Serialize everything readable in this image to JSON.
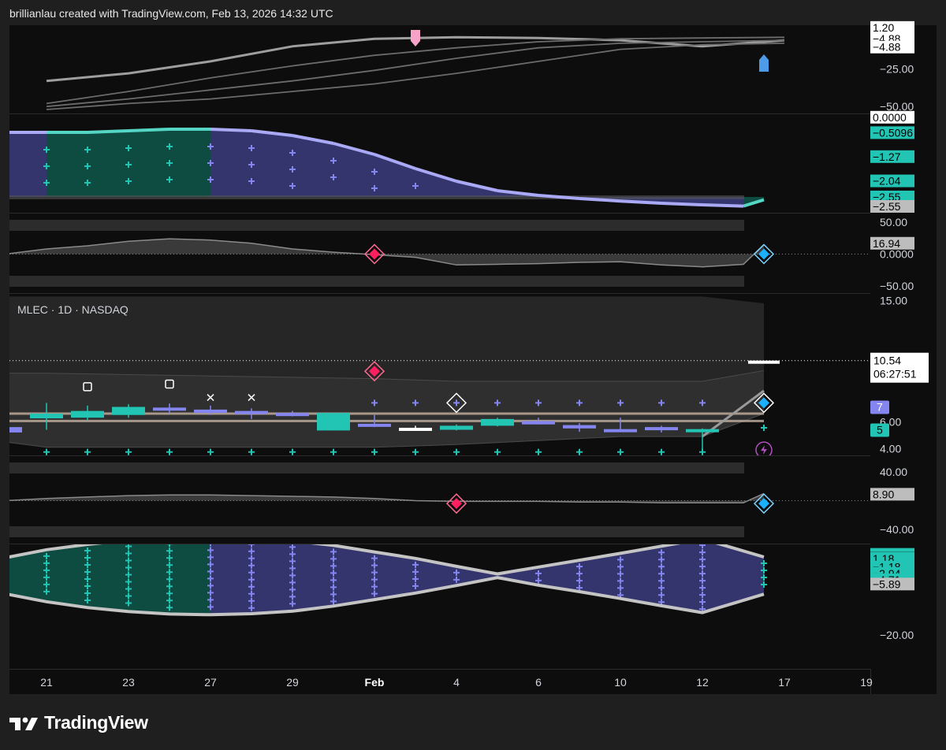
{
  "header": {
    "credit": "brillianlau created with TradingView.com, Feb 13, 2026 14:32 UTC"
  },
  "brand": {
    "name": "TradingView"
  },
  "colors": {
    "teal": "#22c4b4",
    "purple": "#8585f0",
    "teal_fill": "#0e4b40",
    "purple_fill": "#35356e",
    "pink_red": "#ff1f5f",
    "cyan_blue": "#1ab0ff",
    "pink_marker": "#f7a3c8",
    "blue_marker": "#4c9ae8",
    "grey_line": "#9a9a9a",
    "bg": "#0d0d0d",
    "frame": "#1f1f1f"
  },
  "symbol": {
    "label": "MLEC · 1D · NASDAQ"
  },
  "chart_data": [
    {
      "id": "pane1",
      "type": "line",
      "title": "",
      "ylim": [
        -52,
        4
      ],
      "yticks": [
        {
          "v": -25,
          "label": "−25.00"
        },
        {
          "v": -50,
          "label": "−50.00"
        }
      ],
      "price_tags": [
        {
          "v": 2.5,
          "label": "1.20",
          "style": "white",
          "partial": true
        },
        {
          "v": -4.9,
          "label": "−4.88",
          "style": "white"
        },
        {
          "v": -10.5,
          "label": "−4.88",
          "style": "white"
        }
      ],
      "x": [
        0,
        2,
        4,
        6,
        8,
        10,
        12,
        14,
        16,
        18
      ],
      "series": [
        {
          "role": "main",
          "values": [
            -33,
            -28,
            -20,
            -10,
            -5,
            -4,
            -4.5,
            -6,
            -10,
            -6
          ]
        },
        {
          "role": "ma",
          "values": [
            -48,
            -40,
            -31,
            -23,
            -16,
            -11,
            -7,
            -5,
            -4.5,
            -4
          ]
        },
        {
          "role": "ma",
          "values": [
            -50,
            -45,
            -39,
            -33,
            -26,
            -18,
            -11,
            -8,
            -7,
            -6
          ]
        },
        {
          "role": "ma",
          "values": [
            -52,
            -48,
            -45,
            -40,
            -35,
            -28,
            -20,
            -12,
            -9,
            -8
          ]
        }
      ],
      "markers": [
        {
          "x": 9,
          "shape": "flag-down",
          "color": "pink"
        },
        {
          "x": 17.5,
          "shape": "flag-up",
          "color": "blue"
        }
      ]
    },
    {
      "id": "pane2",
      "type": "area",
      "title": "",
      "ylim": [
        -2.85,
        0
      ],
      "price_tags": [
        {
          "v": -0.02,
          "label": "0.0000",
          "style": "white"
        },
        {
          "v": -0.5096,
          "label": "−0.5096",
          "style": "teal"
        },
        {
          "v": -1.27,
          "label": "−1.27",
          "style": "teal"
        },
        {
          "v": -2.04,
          "label": "−2.04",
          "style": "teal"
        },
        {
          "v": -2.55,
          "label": "−2.55",
          "style": "teal"
        },
        {
          "v": -2.85,
          "label": "−2.55",
          "style": "grey"
        }
      ],
      "x": [
        -1,
        0,
        1,
        2,
        3,
        4,
        5,
        6,
        7,
        8,
        9,
        10,
        11,
        12,
        13,
        14,
        15,
        16,
        17,
        17.5
      ],
      "values": [
        -0.5,
        -0.5,
        -0.5,
        -0.45,
        -0.4,
        -0.4,
        -0.45,
        -0.6,
        -0.85,
        -1.2,
        -1.65,
        -2.05,
        -2.35,
        -2.5,
        -2.6,
        -2.68,
        -2.75,
        -2.8,
        -2.84,
        -2.64
      ],
      "baseline": -2.55,
      "segment_colors": [
        "purple",
        "teal",
        "teal",
        "teal",
        "teal",
        "purple",
        "purple",
        "purple",
        "purple",
        "purple",
        "purple",
        "purple",
        "purple",
        "purple",
        "purple",
        "purple",
        "purple",
        "purple",
        "teal",
        "teal"
      ]
    },
    {
      "id": "pane3",
      "type": "area",
      "title": "",
      "ylim": [
        -50,
        50
      ],
      "yticks": [
        {
          "v": 50,
          "label": "50.00"
        },
        {
          "v": 0,
          "label": "0.0000"
        },
        {
          "v": -50,
          "label": "−50.00"
        }
      ],
      "price_tags": [
        {
          "v": 16.94,
          "label": "16.94",
          "style": "grey"
        }
      ],
      "x": [
        -1,
        0,
        1,
        2,
        3,
        4,
        5,
        6,
        7,
        8,
        9,
        10,
        11,
        12,
        13,
        14,
        15,
        16,
        17,
        17.5
      ],
      "values": [
        0,
        8,
        13,
        20,
        24,
        22,
        17,
        8,
        3,
        -1,
        -5,
        -17,
        -16,
        -15,
        -13,
        -12,
        -17,
        -20,
        -16,
        15
      ],
      "markers": [
        {
          "x": 8,
          "v": 0,
          "shape": "diamond",
          "color": "pink"
        },
        {
          "x": 17.5,
          "v": 0,
          "shape": "diamond",
          "color": "blue"
        }
      ]
    },
    {
      "id": "main",
      "type": "candlestick",
      "title": "",
      "ylim": [
        3.5,
        15.5
      ],
      "yticks": [
        {
          "v": 15,
          "label": "15.00"
        },
        {
          "v": 6,
          "label": "6.00"
        },
        {
          "v": 4,
          "label": "4.00"
        }
      ],
      "last_price": {
        "v": 10.54,
        "label": "10.54",
        "countdown": "06:27:51"
      },
      "indicator_labels": [
        {
          "v": 7.1,
          "label": "7",
          "color": "purple"
        },
        {
          "v": 5.4,
          "label": "5",
          "color": "teal"
        }
      ],
      "x_labels": [
        {
          "x": 0,
          "label": "21"
        },
        {
          "x": 2,
          "label": "23"
        },
        {
          "x": 4,
          "label": "27"
        },
        {
          "x": 6,
          "label": "29"
        },
        {
          "x": 8,
          "label": "Feb"
        },
        {
          "x": 10,
          "label": "4"
        },
        {
          "x": 12,
          "label": "6"
        },
        {
          "x": 14,
          "label": "10"
        },
        {
          "x": 16,
          "label": "12"
        },
        {
          "x": 18,
          "label": "17"
        },
        {
          "x": 20,
          "label": "19"
        }
      ],
      "candles": [
        {
          "x": -1,
          "o": 5.6,
          "h": 5.6,
          "l": 5.15,
          "c": 5.2,
          "color": "purple"
        },
        {
          "x": 0,
          "o": 6.25,
          "h": 7.4,
          "l": 5.4,
          "c": 6.6,
          "color": "teal"
        },
        {
          "x": 1,
          "o": 6.3,
          "h": 7.2,
          "l": 6.1,
          "c": 6.8,
          "color": "teal"
        },
        {
          "x": 2,
          "o": 6.5,
          "h": 7.3,
          "l": 6.3,
          "c": 7.1,
          "color": "teal"
        },
        {
          "x": 3,
          "o": 7.05,
          "h": 7.35,
          "l": 6.6,
          "c": 6.95,
          "color": "purple"
        },
        {
          "x": 4,
          "o": 6.9,
          "h": 7.2,
          "l": 6.5,
          "c": 6.65,
          "color": "purple"
        },
        {
          "x": 5,
          "o": 6.8,
          "h": 7.0,
          "l": 6.2,
          "c": 6.6,
          "color": "purple"
        },
        {
          "x": 6,
          "o": 6.65,
          "h": 6.8,
          "l": 6.4,
          "c": 6.55,
          "color": "purple"
        },
        {
          "x": 7,
          "o": 5.35,
          "h": 6.65,
          "l": 5.35,
          "c": 6.65,
          "color": "teal"
        },
        {
          "x": 8,
          "o": 5.85,
          "h": 6.5,
          "l": 5.6,
          "c": 5.7,
          "color": "purple"
        },
        {
          "x": 9,
          "o": 5.55,
          "h": 5.7,
          "l": 5.45,
          "c": 5.45,
          "color": "white"
        },
        {
          "x": 10,
          "o": 5.4,
          "h": 5.8,
          "l": 5.35,
          "c": 5.7,
          "color": "teal"
        },
        {
          "x": 11,
          "o": 5.7,
          "h": 6.3,
          "l": 5.65,
          "c": 6.2,
          "color": "teal"
        },
        {
          "x": 12,
          "o": 6.05,
          "h": 6.3,
          "l": 5.8,
          "c": 5.8,
          "color": "purple"
        },
        {
          "x": 13,
          "o": 5.75,
          "h": 5.9,
          "l": 5.25,
          "c": 5.5,
          "color": "purple"
        },
        {
          "x": 14,
          "o": 5.45,
          "h": 6.3,
          "l": 5.4,
          "c": 5.45,
          "color": "purple"
        },
        {
          "x": 15,
          "o": 5.6,
          "h": 5.7,
          "l": 5.2,
          "c": 5.4,
          "color": "purple"
        },
        {
          "x": 16,
          "o": 5.45,
          "h": 5.5,
          "l": 3.95,
          "c": 5.45,
          "color": "teal"
        },
        {
          "x": 17.5,
          "o": 10.54,
          "h": 10.54,
          "l": 10.54,
          "c": 10.54,
          "color": "white"
        }
      ],
      "bands": {
        "x": [
          -1,
          0,
          2,
          4,
          6,
          8,
          10,
          12,
          14,
          16,
          17.5
        ],
        "upper": [
          9.6,
          9.6,
          9.5,
          9.4,
          9.3,
          9.2,
          9.0,
          9.0,
          9.0,
          9.0,
          9.8
        ],
        "lower": [
          4.5,
          4.1,
          4.1,
          4.1,
          4.1,
          4.1,
          4.3,
          4.6,
          4.9,
          4.9,
          6.6
        ],
        "outer_top": [
          15.3,
          15.3,
          15.3,
          15.3,
          15.3,
          15.3,
          15.3,
          15.3,
          15.3,
          15.3,
          14.8
        ],
        "ma_a": [
          6.6,
          6.6,
          6.6,
          6.6,
          6.6,
          6.6,
          6.6,
          6.6,
          6.6,
          6.6,
          6.6
        ],
        "ma_b": [
          6.05,
          6.05,
          6.05,
          6.05,
          6.05,
          6.05,
          6.05,
          6.05,
          6.05,
          6.05,
          6.05
        ]
      },
      "price_extension": {
        "x": [
          16,
          17.5
        ],
        "values": [
          4.9,
          8.3
        ]
      },
      "top_markers": [
        {
          "x": 1,
          "v": 8.6,
          "shape": "square"
        },
        {
          "x": 3,
          "v": 8.8,
          "shape": "square"
        },
        {
          "x": 4,
          "v": 7.8,
          "shape": "cross"
        },
        {
          "x": 5,
          "v": 7.8,
          "shape": "cross"
        },
        {
          "x": 8,
          "v": 9.75,
          "shape": "diamond",
          "color": "pink"
        },
        {
          "x": 10,
          "v": 7.4,
          "shape": "diamond-outline"
        },
        {
          "x": 17.5,
          "v": 7.4,
          "shape": "diamond",
          "color": "blue"
        }
      ],
      "plus_row_purple": {
        "v": 7.4,
        "from": 8,
        "to": 16
      },
      "plus_row_teal": {
        "v": 3.75,
        "from": 0,
        "to": 16
      },
      "extra_plus": [
        {
          "x": 17.5,
          "v": 5.55,
          "color": "teal"
        }
      ],
      "alert_icon": {
        "x": 17.5,
        "v": 3.9
      }
    },
    {
      "id": "pane5",
      "type": "area",
      "title": "",
      "ylim": [
        -40,
        40
      ],
      "yticks": [
        {
          "v": 40,
          "label": "40.00"
        },
        {
          "v": -40,
          "label": "−40.00"
        }
      ],
      "price_tags": [
        {
          "v": 8.9,
          "label": "8.90",
          "style": "grey"
        }
      ],
      "x": [
        -1,
        0,
        1,
        2,
        3,
        4,
        5,
        6,
        7,
        8,
        9,
        10,
        11,
        12,
        13,
        14,
        15,
        16,
        17,
        17.5
      ],
      "values": [
        0,
        3,
        5,
        7,
        8,
        8,
        7,
        6,
        5,
        3,
        0,
        -1,
        -1,
        -1,
        -2,
        -2,
        -3,
        -3,
        -3,
        10
      ],
      "markers": [
        {
          "x": 10,
          "v": -4,
          "shape": "diamond",
          "color": "pink"
        },
        {
          "x": 17.5,
          "v": -4,
          "shape": "diamond",
          "color": "blue"
        }
      ]
    },
    {
      "id": "pane6",
      "type": "area",
      "title": "",
      "ylim": [
        -20,
        4
      ],
      "price_tags": [
        {
          "v": 3.2,
          "label": "",
          "style": "teal",
          "partial": true
        },
        {
          "v": 1.18,
          "label": "1.18",
          "style": "teal"
        },
        {
          "v": -1.18,
          "label": "−1.18",
          "style": "teal"
        },
        {
          "v": -2.94,
          "label": "−2.94",
          "style": "teal"
        },
        {
          "v": -4.71,
          "label": "−4.71",
          "style": "teal"
        },
        {
          "v": -5.89,
          "label": "−5.89",
          "style": "grey"
        }
      ],
      "yticks": [
        {
          "v": -20,
          "label": "−20.00"
        }
      ],
      "x": [
        -1,
        0,
        1,
        2,
        3,
        4,
        5,
        6,
        7,
        8,
        9,
        10,
        11,
        12,
        13,
        14,
        15,
        16,
        17.5
      ],
      "upper": [
        1.4,
        3.6,
        5.1,
        6.3,
        7.0,
        7.2,
        6.9,
        6.1,
        4.8,
        3.0,
        1.2,
        -1.0,
        -3.1,
        -1.2,
        0.7,
        2.6,
        4.6,
        6.6,
        1.6
      ],
      "lower": [
        -8.6,
        -10.8,
        -12.4,
        -13.5,
        -14.2,
        -14.4,
        -14.1,
        -13.4,
        -12.0,
        -10.2,
        -8.4,
        -6.3,
        -4.1,
        -6.2,
        -8.0,
        -9.9,
        -11.9,
        -13.8,
        -8.7
      ],
      "segment_colors": [
        "teal",
        "teal",
        "teal",
        "teal",
        "teal",
        "purple",
        "purple",
        "purple",
        "purple",
        "purple",
        "purple",
        "purple",
        "purple",
        "purple",
        "purple",
        "purple",
        "purple",
        "purple",
        "teal"
      ]
    }
  ]
}
